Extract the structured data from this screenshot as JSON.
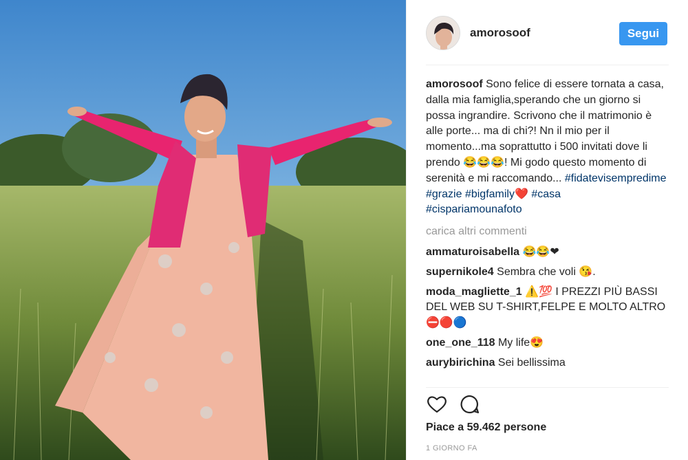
{
  "post": {
    "username": "amorosoof",
    "follow_label": "Segui",
    "caption": {
      "author": "amorosoof",
      "text_1": " Sono felice di essere tornata a casa, dalla mia famiglia,sperando che un giorno si possa ingrandire. Scrivono che il matrimonio è alle porte... ma di chi?! Nn il mio per il momento...ma soprattutto i 500 invitati dove li prendo ",
      "emoji_1": "😂😂😂",
      "text_2": "! Mi godo questo momento di serenità e mi raccomando... ",
      "tag_1": "#fidatevisempredime",
      "tag_2": "#grazie",
      "tag_3": "#bigfamily",
      "emoji_2": "❤️",
      "tag_4": "#casa",
      "tag_5": "#cispariamounafoto"
    },
    "load_more": "carica altri commenti",
    "comments": [
      {
        "user": "ammaturoisabella",
        "text": " 😂😂❤"
      },
      {
        "user": "supernikole4",
        "text": " Sembra che voli 😘."
      },
      {
        "user": "moda_magliette_1",
        "text": " ⚠️💯 I PREZZI PIÙ BASSI DEL WEB SU T-SHIRT,FELPE E MOLTO ALTRO⛔🔴🔵"
      },
      {
        "user": "one_one_118",
        "text": " My life😍"
      },
      {
        "user": "aurybirichina",
        "text": " Sei bellissima"
      }
    ],
    "likes": "Piace a 59.462 persone",
    "time": "1 GIORNO FA",
    "icons": {
      "like": "heart-icon",
      "comment": "comment-icon"
    },
    "colors": {
      "follow": "#3897f0",
      "hashtag": "#003569",
      "muted": "#999999"
    }
  }
}
